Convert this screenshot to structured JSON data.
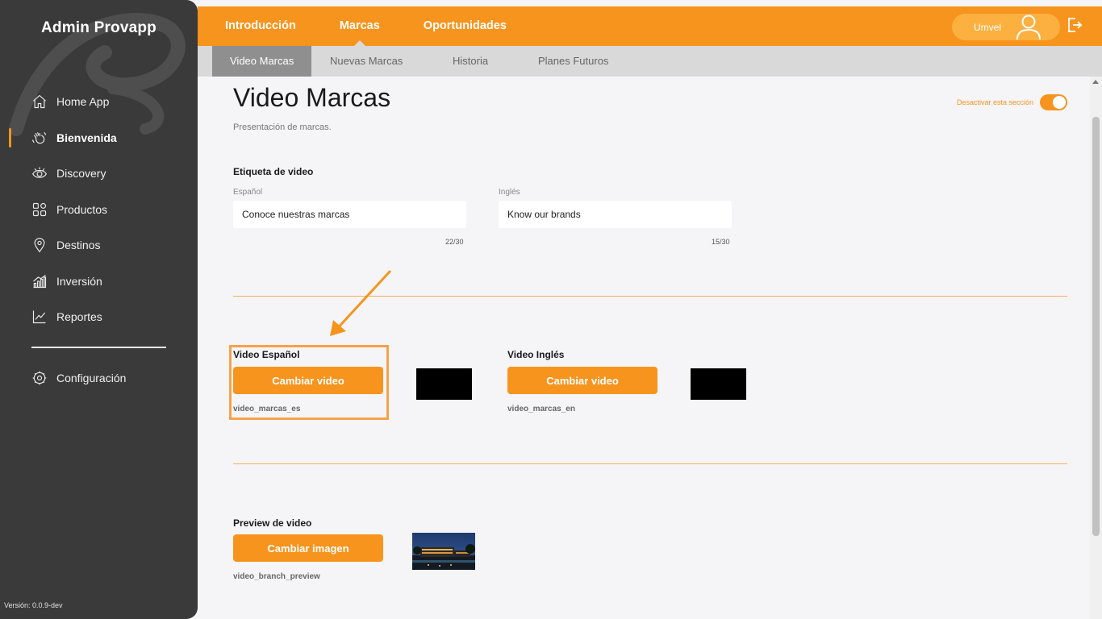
{
  "app": {
    "title": "Admin Provapp",
    "version": "Versión: 0.0.9-dev"
  },
  "sidebar": {
    "items": [
      {
        "label": "Home App",
        "icon": "home-icon"
      },
      {
        "label": "Bienvenida",
        "icon": "wave-hand-icon",
        "active": true
      },
      {
        "label": "Discovery",
        "icon": "eye-icon"
      },
      {
        "label": "Productos",
        "icon": "grid-icon"
      },
      {
        "label": "Destinos",
        "icon": "location-pin-icon"
      },
      {
        "label": "Inversión",
        "icon": "bar-growth-icon"
      },
      {
        "label": "Reportes",
        "icon": "line-chart-icon"
      }
    ],
    "config": {
      "label": "Configuración",
      "icon": "gear-icon"
    }
  },
  "topbar": {
    "tabs": [
      {
        "label": "Introducción"
      },
      {
        "label": "Marcas",
        "active": true
      },
      {
        "label": "Oportunidades"
      }
    ],
    "user_name": "Umvel"
  },
  "subtabs": [
    {
      "label": "Video Marcas",
      "active": true
    },
    {
      "label": "Nuevas Marcas"
    },
    {
      "label": "Historia"
    },
    {
      "label": "Planes Futuros"
    }
  ],
  "page": {
    "title": "Video Marcas",
    "subtitle": "Presentación de marcas.",
    "toggle_label": "Desactivar esta sección"
  },
  "video_label": {
    "section_title": "Etiqueta de video",
    "es": {
      "label": "Español",
      "value": "Conoce nuestras marcas",
      "counter": "22/30"
    },
    "en": {
      "label": "Inglés",
      "value": "Know our brands",
      "counter": "15/30"
    }
  },
  "videos": {
    "es": {
      "title": "Video Español",
      "button": "Cambiar video",
      "filename": "video_marcas_es"
    },
    "en": {
      "title": "Video Inglés",
      "button": "Cambiar video",
      "filename": "video_marcas_en"
    }
  },
  "preview": {
    "title": "Preview de video",
    "button": "Cambiar imagen",
    "filename": "video_branch_preview"
  },
  "colors": {
    "accent": "#f7941d",
    "sidebar": "#3a3a3a",
    "subbar": "#d9d9d9"
  }
}
